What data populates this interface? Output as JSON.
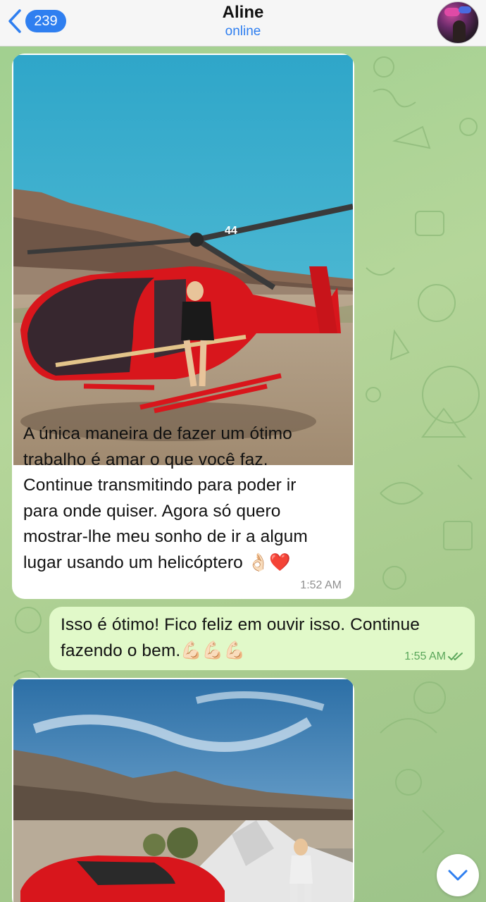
{
  "header": {
    "unread_count": "239",
    "contact_name": "Aline",
    "contact_status": "online"
  },
  "messages": [
    {
      "type": "incoming-photo",
      "photo_icon": "helicopter-photo",
      "text": "A única maneira de fazer um ótimo trabalho é amar o que você faz. Continue transmitindo para poder ir para onde quiser. Agora só quero mostrar-lhe meu sonho de ir a algum lugar usando um helicóptero 👌🏻❤️",
      "lines": [
        "A única maneira de fazer um ótimo",
        "trabalho é amar o que você faz.",
        "Continue transmitindo para poder ir",
        "para onde quiser. Agora só quero",
        "mostrar-lhe meu sonho de ir a algum",
        "lugar usando um helicóptero 👌🏻❤️"
      ],
      "time": "1:52 AM"
    },
    {
      "type": "outgoing-text",
      "lines": [
        "Isso é ótimo! Fico feliz em ouvir isso. Continue",
        "fazendo o bem.💪🏻💪🏻💪🏻"
      ],
      "time": "1:55 AM",
      "read_status": "read-double-check-icon"
    },
    {
      "type": "incoming-photo",
      "photo_icon": "sports-car-photo"
    }
  ],
  "colors": {
    "accent": "#2f7ff0",
    "outgoing_bubble": "#e1f9c9",
    "incoming_bubble": "#ffffff",
    "wallpaper": "#a9c98c",
    "read_check": "#5aa65a"
  }
}
